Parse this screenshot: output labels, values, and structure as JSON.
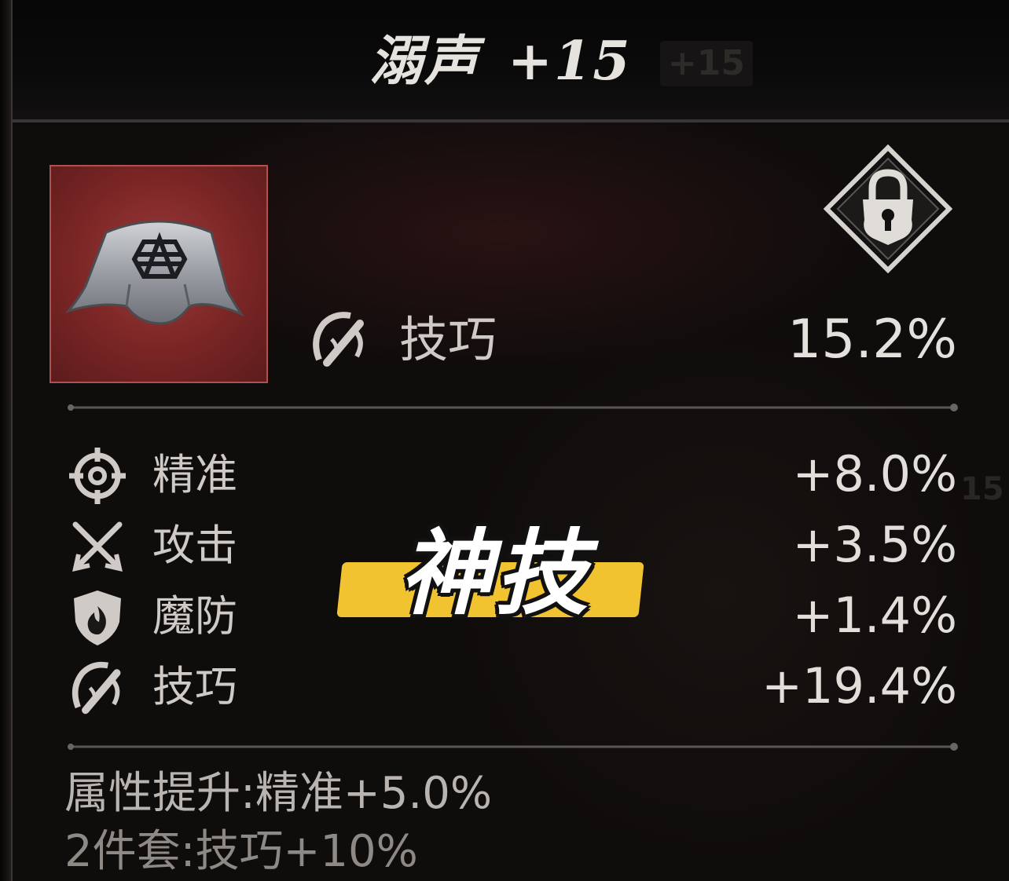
{
  "item": {
    "name": "溺声",
    "level": "+15",
    "ghost_level": "+15"
  },
  "main_stat": {
    "label": "技巧",
    "value": "15.2%",
    "icon": "skill-slash-icon"
  },
  "sub_stats": [
    {
      "label": "精准",
      "value": "+8.0%",
      "icon": "crosshair-icon"
    },
    {
      "label": "攻击",
      "value": "+3.5%",
      "icon": "crossed-swords-icon"
    },
    {
      "label": "魔防",
      "value": "+1.4%",
      "icon": "flame-shield-icon"
    },
    {
      "label": "技巧",
      "value": "+19.4%",
      "icon": "skill-slash-icon"
    }
  ],
  "footer": {
    "attribute_boost": "属性提升:精准+5.0%",
    "set_bonus": "2件套:技巧+10%"
  },
  "overlay": {
    "stamp_text": "神技",
    "stamp_color": "#f1c330"
  },
  "colors": {
    "item_frame": "#7a2525",
    "text": "#d9d6d2"
  },
  "ghost_text": "15"
}
